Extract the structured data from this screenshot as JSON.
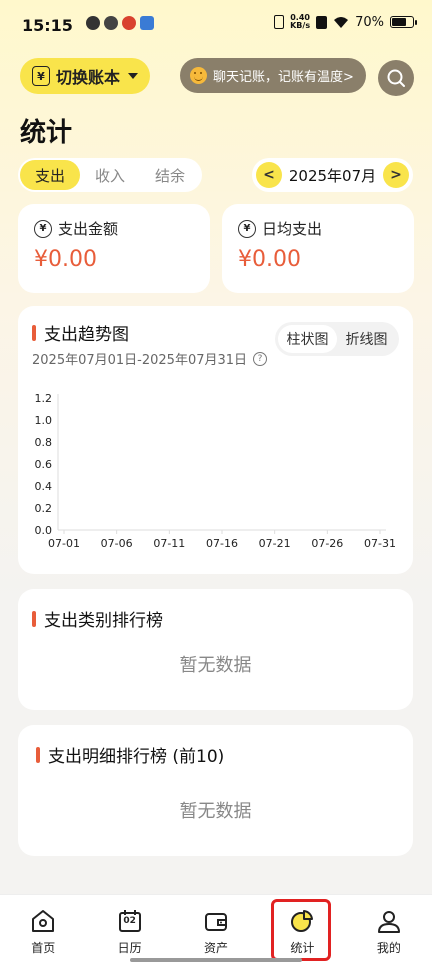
{
  "status_bar": {
    "time": "15:15",
    "net_speed_value": "0.40",
    "net_speed_unit": "KB/s",
    "battery": "70%"
  },
  "top": {
    "switch_account_label": "切换账本",
    "chat_prompt": "聊天记账，记账有温度>"
  },
  "page_title": "统计",
  "tabs": [
    {
      "label": "支出",
      "active": true
    },
    {
      "label": "收入",
      "active": false
    },
    {
      "label": "结余",
      "active": false
    }
  ],
  "month": {
    "label": "2025年07月",
    "prev": "<",
    "next": ">"
  },
  "summary": {
    "total_label": "支出金额",
    "total_value": "¥0.00",
    "daily_label": "日均支出",
    "daily_value": "¥0.00"
  },
  "trend": {
    "title": "支出趋势图",
    "toggle_bar": "柱状图",
    "toggle_line": "折线图",
    "date_range": "2025年07月01日-2025年07月31日"
  },
  "chart_data": {
    "type": "bar",
    "title": "",
    "xlabel": "",
    "ylabel": "",
    "x_ticks": [
      "07-01",
      "07-06",
      "07-11",
      "07-16",
      "07-21",
      "07-26",
      "07-31"
    ],
    "y_ticks": [
      "0.0",
      "0.2",
      "0.4",
      "0.6",
      "0.8",
      "1.0",
      "1.2"
    ],
    "ylim": [
      0,
      1.2
    ],
    "series": [],
    "grid": false
  },
  "category_rank": {
    "title": "支出类别排行榜",
    "empty": "暂无数据"
  },
  "detail_rank": {
    "title": "支出明细排行榜 (前10)",
    "empty": "暂无数据"
  },
  "nav": [
    {
      "label": "首页",
      "icon": "home-icon"
    },
    {
      "label": "日历",
      "icon": "calendar-icon",
      "badge": "02"
    },
    {
      "label": "资产",
      "icon": "wallet-icon"
    },
    {
      "label": "统计",
      "icon": "pie-chart-icon",
      "active": true
    },
    {
      "label": "我的",
      "icon": "profile-icon"
    }
  ],
  "colors": {
    "accent": "#F9E44B",
    "amount": "#E85D3A",
    "highlight_box": "#E12222"
  }
}
